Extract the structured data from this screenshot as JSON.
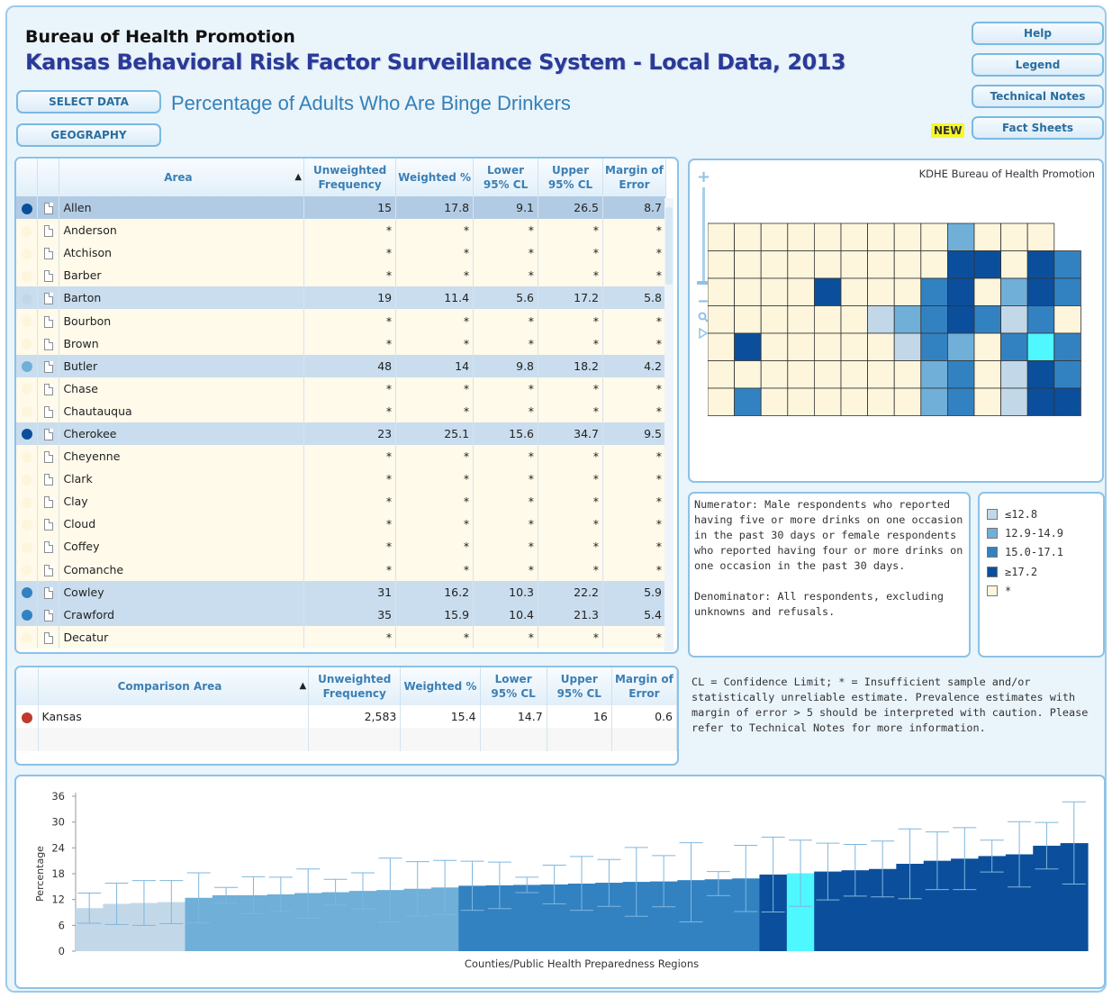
{
  "header": {
    "org": "Bureau of Health Promotion",
    "title": "Kansas Behavioral Risk Factor Surveillance System - Local Data, 2013",
    "page_title": "Percentage of Adults Who Are Binge Drinkers",
    "new_badge": "NEW"
  },
  "buttons": {
    "select_data": "SELECT DATA",
    "geography": "GEOGRAPHY",
    "help": "Help",
    "legend": "Legend",
    "technical_notes": "Technical Notes",
    "fact_sheets": "Fact Sheets"
  },
  "colors": {
    "q1": "#c2d8e8",
    "q2": "#6fafd8",
    "q3": "#3282c2",
    "q4": "#0b4f9c",
    "none": "#fdf6dc",
    "state": "#c0392b",
    "highlight": "#4ff7ff"
  },
  "area_table": {
    "headers": {
      "area": "Area",
      "sort_icon": "▲",
      "unweighted": "Unweighted Frequency",
      "weighted": "Weighted %",
      "lower": "Lower 95% CL",
      "upper": "Upper 95% CL",
      "moe": "Margin of Error"
    },
    "rows": [
      {
        "area": "Allen",
        "uw": "15",
        "w": "17.8",
        "lo": "9.1",
        "up": "26.5",
        "moe": "8.7",
        "q": "q4"
      },
      {
        "area": "Anderson",
        "uw": "*",
        "w": "*",
        "lo": "*",
        "up": "*",
        "moe": "*",
        "q": "none"
      },
      {
        "area": "Atchison",
        "uw": "*",
        "w": "*",
        "lo": "*",
        "up": "*",
        "moe": "*",
        "q": "none"
      },
      {
        "area": "Barber",
        "uw": "*",
        "w": "*",
        "lo": "*",
        "up": "*",
        "moe": "*",
        "q": "none"
      },
      {
        "area": "Barton",
        "uw": "19",
        "w": "11.4",
        "lo": "5.6",
        "up": "17.2",
        "moe": "5.8",
        "q": "q1"
      },
      {
        "area": "Bourbon",
        "uw": "*",
        "w": "*",
        "lo": "*",
        "up": "*",
        "moe": "*",
        "q": "none"
      },
      {
        "area": "Brown",
        "uw": "*",
        "w": "*",
        "lo": "*",
        "up": "*",
        "moe": "*",
        "q": "none"
      },
      {
        "area": "Butler",
        "uw": "48",
        "w": "14",
        "lo": "9.8",
        "up": "18.2",
        "moe": "4.2",
        "q": "q2"
      },
      {
        "area": "Chase",
        "uw": "*",
        "w": "*",
        "lo": "*",
        "up": "*",
        "moe": "*",
        "q": "none"
      },
      {
        "area": "Chautauqua",
        "uw": "*",
        "w": "*",
        "lo": "*",
        "up": "*",
        "moe": "*",
        "q": "none"
      },
      {
        "area": "Cherokee",
        "uw": "23",
        "w": "25.1",
        "lo": "15.6",
        "up": "34.7",
        "moe": "9.5",
        "q": "q4"
      },
      {
        "area": "Cheyenne",
        "uw": "*",
        "w": "*",
        "lo": "*",
        "up": "*",
        "moe": "*",
        "q": "none"
      },
      {
        "area": "Clark",
        "uw": "*",
        "w": "*",
        "lo": "*",
        "up": "*",
        "moe": "*",
        "q": "none"
      },
      {
        "area": "Clay",
        "uw": "*",
        "w": "*",
        "lo": "*",
        "up": "*",
        "moe": "*",
        "q": "none"
      },
      {
        "area": "Cloud",
        "uw": "*",
        "w": "*",
        "lo": "*",
        "up": "*",
        "moe": "*",
        "q": "none"
      },
      {
        "area": "Coffey",
        "uw": "*",
        "w": "*",
        "lo": "*",
        "up": "*",
        "moe": "*",
        "q": "none"
      },
      {
        "area": "Comanche",
        "uw": "*",
        "w": "*",
        "lo": "*",
        "up": "*",
        "moe": "*",
        "q": "none"
      },
      {
        "area": "Cowley",
        "uw": "31",
        "w": "16.2",
        "lo": "10.3",
        "up": "22.2",
        "moe": "5.9",
        "q": "q3"
      },
      {
        "area": "Crawford",
        "uw": "35",
        "w": "15.9",
        "lo": "10.4",
        "up": "21.3",
        "moe": "5.4",
        "q": "q3"
      },
      {
        "area": "Decatur",
        "uw": "*",
        "w": "*",
        "lo": "*",
        "up": "*",
        "moe": "*",
        "q": "none"
      }
    ]
  },
  "comparison_table": {
    "headers": {
      "area": "Comparison Area",
      "sort_icon": "▲",
      "unweighted": "Unweighted Frequency",
      "weighted": "Weighted %",
      "lower": "Lower 95% CL",
      "upper": "Upper 95% CL",
      "moe": "Margin of Error"
    },
    "rows": [
      {
        "area": "Kansas",
        "uw": "2,583",
        "w": "15.4",
        "lo": "14.7",
        "up": "16",
        "moe": "0.6"
      }
    ]
  },
  "map": {
    "credit": "KDHE Bureau of Health Promotion",
    "zoom_in": "+",
    "zoom_out": "−",
    "search_icon": "magnifier-icon",
    "play_icon": "play-icon"
  },
  "notes": {
    "numerator": "Numerator: Male respondents who reported having five or more drinks on one occasion in the past 30 days or female respondents who reported having four or more drinks on one occasion in the past 30 days.",
    "denominator": "Denominator: All respondents, excluding unknowns and refusals.",
    "footnote": "CL = Confidence Limit; * = Insufficient sample and/or statistically unreliable estimate.  Prevalence estimates with margin of error > 5 should be interpreted with caution.  Please refer to Technical Notes for more information."
  },
  "legend": [
    {
      "label": "≤12.8",
      "color": "#c2d8e8"
    },
    {
      "label": "12.9-14.9",
      "color": "#6fafd8"
    },
    {
      "label": "15.0-17.1",
      "color": "#3282c2"
    },
    {
      "label": "≥17.2",
      "color": "#0b4f9c"
    },
    {
      "label": "*",
      "color": "#fdf6dc"
    }
  ],
  "chart_data": {
    "type": "bar",
    "ylabel": "Percentage",
    "xlabel": "Counties/Public Health Preparedness Regions",
    "ylim": [
      0,
      36
    ],
    "yticks": [
      0,
      6,
      12,
      18,
      24,
      30,
      36
    ],
    "values": [
      10,
      11,
      11.2,
      11.4,
      12.4,
      13,
      13,
      13.2,
      13.5,
      13.7,
      14,
      14.2,
      14.5,
      14.8,
      15.2,
      15.3,
      15.4,
      15.5,
      15.7,
      15.9,
      16.1,
      16.2,
      16.5,
      16.7,
      16.9,
      17.8,
      18.1,
      18.5,
      18.8,
      19.1,
      20.3,
      21,
      21.5,
      22.1,
      22.5,
      24.5,
      25.1
    ],
    "lower": [
      6.5,
      6.2,
      6.0,
      6.4,
      6.6,
      11.2,
      8.7,
      9.2,
      7.7,
      10.7,
      9.8,
      6.8,
      8.2,
      8.5,
      9.5,
      9.9,
      13.6,
      11,
      9.5,
      10.4,
      8.1,
      10.3,
      6.8,
      12.9,
      9.2,
      9.1,
      10.4,
      11.9,
      12.8,
      12.6,
      12.2,
      14.3,
      14.3,
      18.4,
      14.9,
      19.1,
      15.6
    ],
    "upper": [
      13.5,
      15.8,
      16.4,
      16.4,
      18.2,
      14.8,
      17.3,
      17.2,
      19.1,
      16.7,
      18.2,
      21.6,
      20.8,
      21.1,
      20.9,
      20.7,
      17.2,
      20.0,
      22.0,
      21.3,
      24.1,
      22.2,
      25.2,
      18.5,
      24.6,
      26.5,
      25.8,
      25.1,
      24.8,
      25.6,
      28.4,
      27.7,
      28.7,
      25.8,
      30.1,
      29.9,
      34.7
    ],
    "classes": [
      "q1",
      "q1",
      "q1",
      "q1",
      "q2",
      "q2",
      "q2",
      "q2",
      "q2",
      "q2",
      "q2",
      "q2",
      "q2",
      "q2",
      "q3",
      "q3",
      "q3",
      "q3",
      "q3",
      "q3",
      "q3",
      "q3",
      "q3",
      "q3",
      "q3",
      "q4",
      "hl",
      "q4",
      "q4",
      "q4",
      "q4",
      "q4",
      "q4",
      "q4",
      "q4",
      "q4",
      "q4"
    ]
  }
}
